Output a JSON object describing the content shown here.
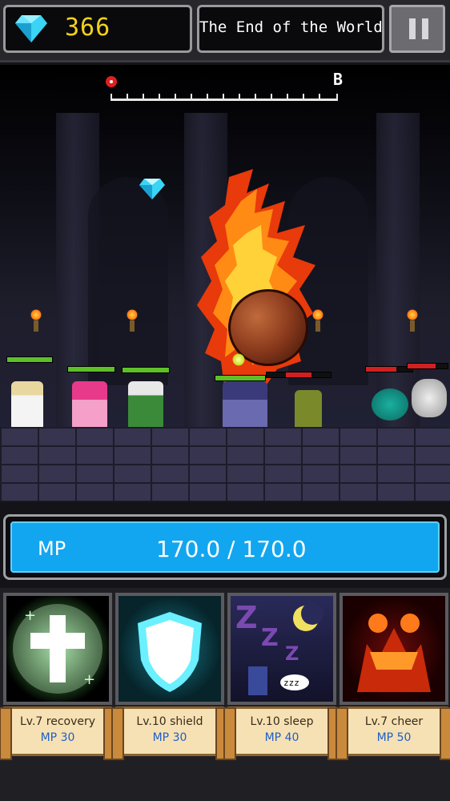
{
  "header": {
    "gem_icon": "diamond-icon",
    "gem_count": "366",
    "stage_name": "The End of the World",
    "pause_icon": "pause-icon"
  },
  "stage_progress": {
    "end_label": "B",
    "marker_icon": "location-pin-icon",
    "progress_fraction": 0.0
  },
  "mp": {
    "label": "MP",
    "value_text": "170.0 / 170.0",
    "current": 170.0,
    "max": 170.0,
    "bar_color": "#12a6f0"
  },
  "skills": [
    {
      "name": "Lv.7 recovery",
      "cost": "MP 30",
      "icon": "holy-cross-icon"
    },
    {
      "name": "Lv.10 shield",
      "cost": "MP 30",
      "icon": "shield-icon"
    },
    {
      "name": "Lv.10 sleep",
      "cost": "MP 40",
      "icon": "moon-sleep-icon"
    },
    {
      "name": "Lv.7 cheer",
      "cost": "MP 50",
      "icon": "demon-face-icon"
    }
  ],
  "allies": [
    {
      "unit": "priestess",
      "hp": 1.0
    },
    {
      "unit": "mage",
      "hp": 1.0
    },
    {
      "unit": "archer",
      "hp": 1.0
    },
    {
      "unit": "warrior",
      "hp": 1.0
    }
  ],
  "enemies": [
    {
      "unit": "zombie",
      "hp": 0.4
    },
    {
      "unit": "eye-blob",
      "hp": 0.65
    },
    {
      "unit": "skull",
      "hp": 0.7
    }
  ],
  "colors": {
    "gem_count": "#f2d21c",
    "ally_hp": "#5ec028",
    "enemy_hp": "#d02020",
    "mp_cost": "#1e5ec8"
  }
}
